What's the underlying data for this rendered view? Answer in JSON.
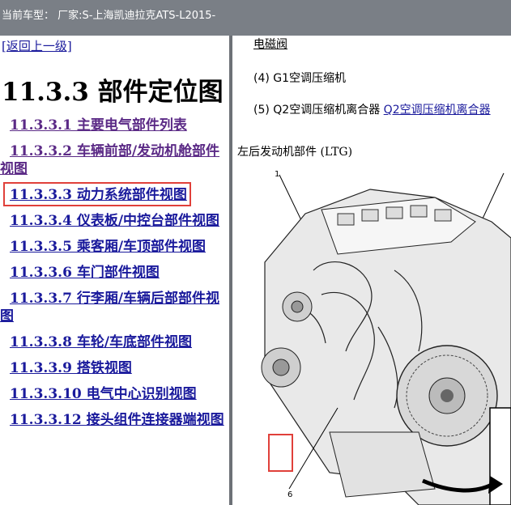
{
  "topbar": {
    "text": "当前车型： 厂家:S-上海凯迪拉克ATS-L2015-"
  },
  "left": {
    "back_link": "[返回上一级]",
    "heading": "11.3.3 部件定位图",
    "toc": [
      {
        "label": "11.3.3.1 主要电气部件列表"
      },
      {
        "label": "11.3.3.2 车辆前部/发动机舱部件视图"
      },
      {
        "label": "11.3.3.3 动力系统部件视图"
      },
      {
        "label": "11.3.3.4 仪表板/中控台部件视图"
      },
      {
        "label": "11.3.3.5 乘客厢/车顶部件视图"
      },
      {
        "label": "11.3.3.6 车门部件视图"
      },
      {
        "label": "11.3.3.7 行李厢/车辆后部部件视图"
      },
      {
        "label": "11.3.3.8 车轮/车底部件视图"
      },
      {
        "label": "11.3.3.9 搭铁视图"
      },
      {
        "label": "11.3.3.10 电气中心识别视图"
      },
      {
        "label": "11.3.3.12 接头组件连接器端视图"
      }
    ]
  },
  "right": {
    "top_link": "电磁阀",
    "item4": "(4) G1空调压缩机",
    "item5_prefix": "(5) Q2空调压缩机离合器",
    "item5_link": "Q2空调压缩机离合器",
    "caption": "左后发动机部件 (LTG)",
    "callout1": "1",
    "callout6": "6"
  }
}
